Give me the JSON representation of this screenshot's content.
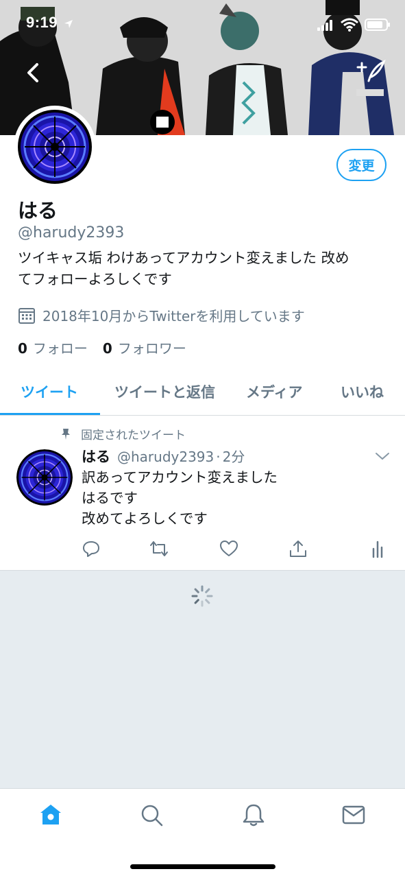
{
  "status_bar": {
    "time": "9:19"
  },
  "profile": {
    "display_name": "はる",
    "handle": "@harudy2393",
    "bio_line1": "ツイキャス垢 わけあってアカウント変えました 改め",
    "bio_line2": "てフォローよろしくです",
    "joined": "2018年10月からTwitterを利用しています",
    "following_count": "0",
    "following_label": "フォロー",
    "followers_count": "0",
    "followers_label": "フォロワー",
    "edit_label": "変更"
  },
  "tabs": [
    {
      "label": "ツイート",
      "active": true
    },
    {
      "label": "ツイートと返信",
      "active": false
    },
    {
      "label": "メディア",
      "active": false
    },
    {
      "label": "いいね",
      "active": false
    }
  ],
  "tweet": {
    "pinned_label": "固定されたツイート",
    "name": "はる",
    "handle": "@harudy2393",
    "dot": "·",
    "time": "2分",
    "lines": [
      "訳あってアカウント変えました",
      "はるです",
      "改めてよろしくです"
    ]
  },
  "icons": {
    "back": "chevron-left-icon",
    "compose": "compose-tweet-icon",
    "calendar": "calendar-icon",
    "pin": "pin-icon",
    "reply": "reply-icon",
    "retweet": "retweet-icon",
    "like": "heart-icon",
    "share": "share-icon",
    "analytics": "analytics-icon",
    "home": "home-icon",
    "search": "search-icon",
    "notifications": "bell-icon",
    "messages": "mail-icon"
  },
  "colors": {
    "accent": "#1da1f2",
    "secondary_text": "#657786",
    "feed_background": "#e6ecf0"
  }
}
